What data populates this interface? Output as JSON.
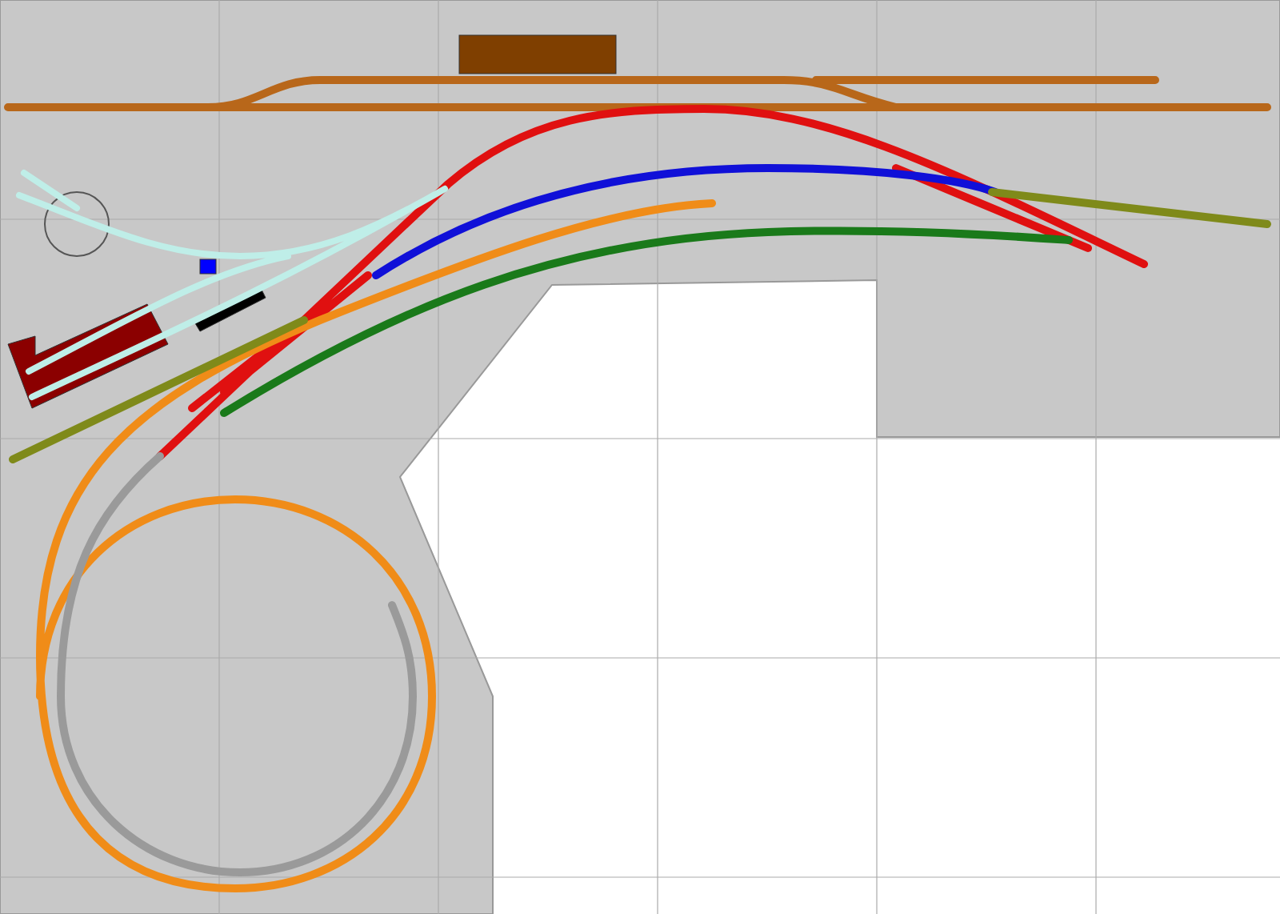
{
  "tracks": [
    {
      "kind": "main",
      "color": "#b8671a"
    },
    {
      "kind": "main",
      "color": "#e01010"
    },
    {
      "kind": "main",
      "color": "#1010d8"
    },
    {
      "kind": "main",
      "color": "#f08c18"
    },
    {
      "kind": "main",
      "color": "#1a7a1a"
    },
    {
      "kind": "main",
      "color": "#7f8a1a"
    },
    {
      "kind": "main",
      "color": "#9a9a9a"
    },
    {
      "kind": "yard",
      "color": "#bfeee8"
    }
  ],
  "structures": [
    {
      "kind": "station",
      "color": "#7f3f00"
    },
    {
      "kind": "shed",
      "color": "#8b0000"
    },
    {
      "kind": "platform",
      "color": "#000000"
    },
    {
      "kind": "cabin",
      "color": "#0000ff"
    }
  ]
}
